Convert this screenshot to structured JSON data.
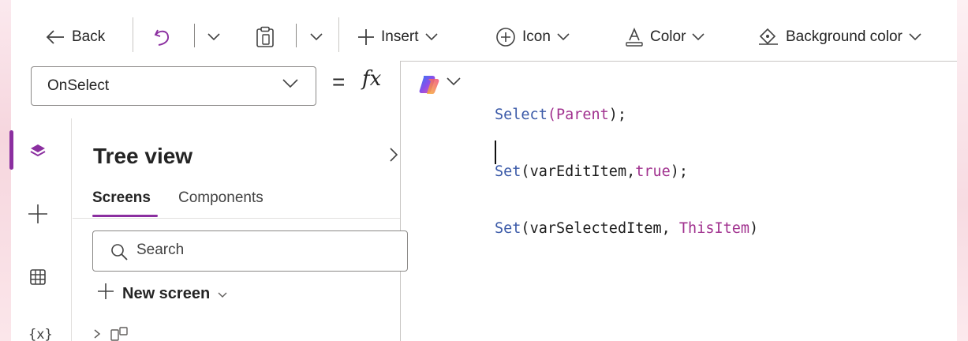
{
  "toolbar": {
    "back_label": "Back",
    "insert_label": "Insert",
    "icon_label": "Icon",
    "color_label": "Color",
    "background_color_label": "Background color",
    "icons": [
      "back-arrow-icon",
      "undo-icon",
      "paste-icon",
      "plus-icon",
      "add-circle-icon",
      "text-color-icon",
      "paint-bucket-icon"
    ]
  },
  "formula_bar": {
    "property": "OnSelect",
    "equals": "=",
    "fx": "fx"
  },
  "editor": {
    "lines": [
      {
        "fn": "Select",
        "open": "(",
        "arg": "Parent",
        "close": ");"
      },
      {
        "fn": "Set",
        "open": "(",
        "arg": "varEditItem",
        "sep": ",",
        "val": "true",
        "close": ");"
      },
      {
        "fn": "Set",
        "open": "(",
        "arg": "varSelectedItem",
        "sep": ", ",
        "val": "ThisItem",
        "close": ")"
      }
    ]
  },
  "rail": {
    "items": [
      "layers-icon",
      "plus-icon",
      "table-icon",
      "variables-icon"
    ],
    "variables_label": "{x}"
  },
  "tree_view": {
    "title": "Tree view",
    "tabs": [
      "Screens",
      "Components"
    ],
    "active_tab": "Screens",
    "search_placeholder": "Search",
    "new_screen_label": "New screen"
  },
  "colors": {
    "accent": "#8b2fa0",
    "code_function": "#3b5aa8",
    "code_keyword": "#a1328f"
  }
}
